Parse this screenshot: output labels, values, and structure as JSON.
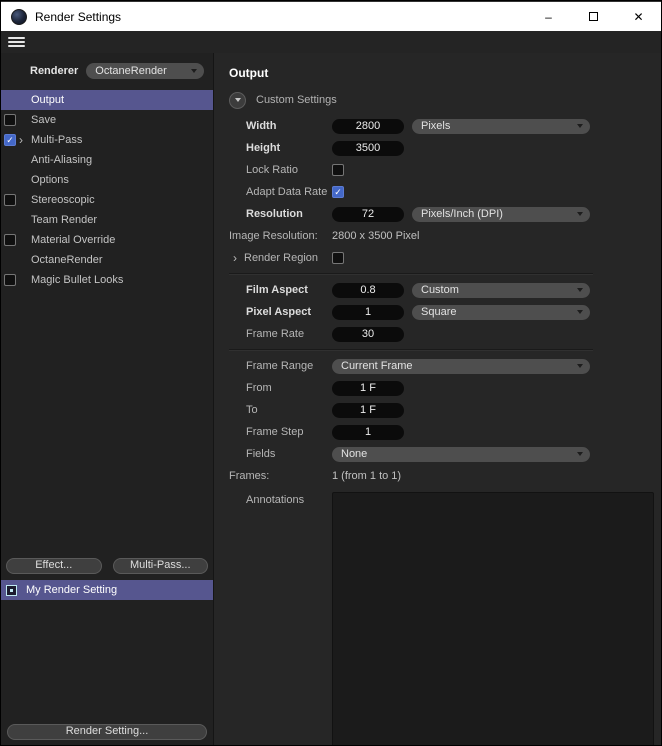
{
  "window": {
    "title": "Render Settings"
  },
  "icons": {
    "minimize": "–",
    "close": "✕",
    "check": "✓",
    "chevron_right": "›"
  },
  "sidebar": {
    "renderer_label": "Renderer",
    "renderer_value": "OctaneRender",
    "items": [
      {
        "label": "Output",
        "selected": true
      },
      {
        "label": "Save",
        "checkbox": false
      },
      {
        "label": "Multi-Pass",
        "checkbox": true,
        "expandable": true
      },
      {
        "label": "Anti-Aliasing"
      },
      {
        "label": "Options"
      },
      {
        "label": "Stereoscopic",
        "checkbox": false
      },
      {
        "label": "Team Render"
      },
      {
        "label": "Material Override",
        "checkbox": false
      },
      {
        "label": "OctaneRender"
      },
      {
        "label": "Magic Bullet Looks",
        "checkbox": false
      }
    ],
    "effect_button": "Effect...",
    "multipass_button": "Multi-Pass...",
    "preset_name": "My Render Setting",
    "render_setting_button": "Render Setting..."
  },
  "output": {
    "title": "Output",
    "custom_settings_label": "Custom Settings",
    "width": {
      "label": "Width",
      "value": "2800",
      "unit": "Pixels"
    },
    "height": {
      "label": "Height",
      "value": "3500"
    },
    "lock_ratio": {
      "label": "Lock Ratio",
      "checked": false
    },
    "adapt_data_rate": {
      "label": "Adapt Data Rate",
      "checked": true
    },
    "resolution": {
      "label": "Resolution",
      "value": "72",
      "unit": "Pixels/Inch (DPI)"
    },
    "image_resolution": {
      "label": "Image Resolution:",
      "value": "2800 x 3500 Pixel"
    },
    "render_region": {
      "label": "Render Region",
      "checked": false
    },
    "film_aspect": {
      "label": "Film Aspect",
      "value": "0.8",
      "unit": "Custom"
    },
    "pixel_aspect": {
      "label": "Pixel Aspect",
      "value": "1",
      "unit": "Square"
    },
    "frame_rate": {
      "label": "Frame Rate",
      "value": "30"
    },
    "frame_range": {
      "label": "Frame Range",
      "value": "Current Frame"
    },
    "from": {
      "label": "From",
      "value": "1 F"
    },
    "to": {
      "label": "To",
      "value": "1 F"
    },
    "frame_step": {
      "label": "Frame Step",
      "value": "1"
    },
    "fields": {
      "label": "Fields",
      "value": "None"
    },
    "frames": {
      "label": "Frames:",
      "value": "1 (from 1 to 1)"
    },
    "annotations": {
      "label": "Annotations"
    }
  },
  "colors": {
    "selection": "#56568f",
    "checkbox_checked": "#4468c8",
    "titlebar_bg": "#ffffff",
    "panel_bg": "#262626"
  }
}
